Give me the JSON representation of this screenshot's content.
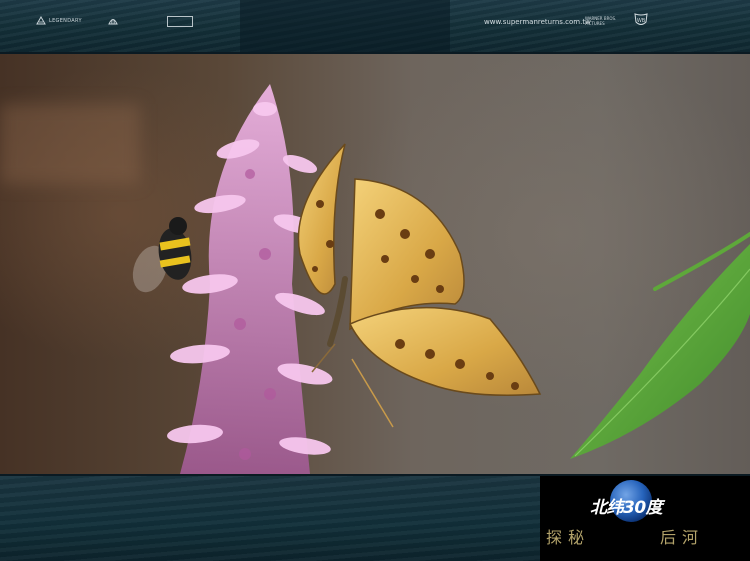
{
  "header": {
    "logos": [
      {
        "icon": "legendary-pictures-logo",
        "text": "LEGENDARY"
      },
      {
        "icon": "shell-logo",
        "text": ""
      },
      {
        "icon": "studio-logo",
        "text": ""
      }
    ],
    "website": "www.supermanreturns.com.tw",
    "wb_text": "WARNER BROS. PICTURES",
    "wb_icon": "wb-shield-icon"
  },
  "photo": {
    "subjects": [
      "butterfly",
      "bee",
      "pink-flower-spike",
      "green-leaf"
    ]
  },
  "badge": {
    "title": "北纬30度",
    "line_left": "探秘",
    "line_right": "后河",
    "globe_icon": "globe-icon"
  },
  "colors": {
    "frame_teal": "#143039",
    "badge_gold": "#b3a36a",
    "flower_pink": "#d98ad1",
    "leaf_green": "#5ea83a",
    "wing_gold": "#e2b24a"
  }
}
